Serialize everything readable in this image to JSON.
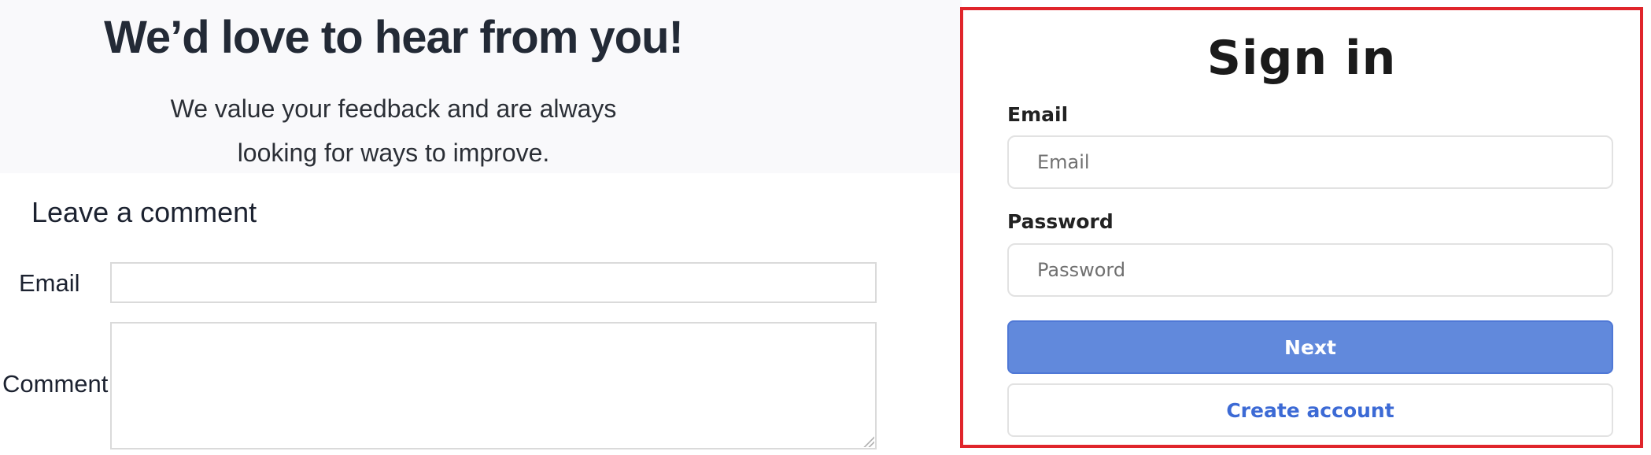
{
  "feedback": {
    "title": "We’d love to hear from you!",
    "subtitle_line1": "We value your feedback and are always",
    "subtitle_line2": "looking for ways to improve.",
    "section_heading": "Leave a comment",
    "email_label": "Email",
    "email_value": "",
    "comment_label": "Comment",
    "comment_value": ""
  },
  "signin": {
    "title": "Sign in",
    "email_label": "Email",
    "email_placeholder": "Email",
    "password_label": "Password",
    "password_placeholder": "Password",
    "next_button": "Next",
    "create_account_button": "Create account"
  },
  "colors": {
    "hero_background": "#f9f9fb",
    "panel_border": "#e0252b",
    "next_button_bg": "#6189dc",
    "link_blue": "#3c6ad5"
  }
}
